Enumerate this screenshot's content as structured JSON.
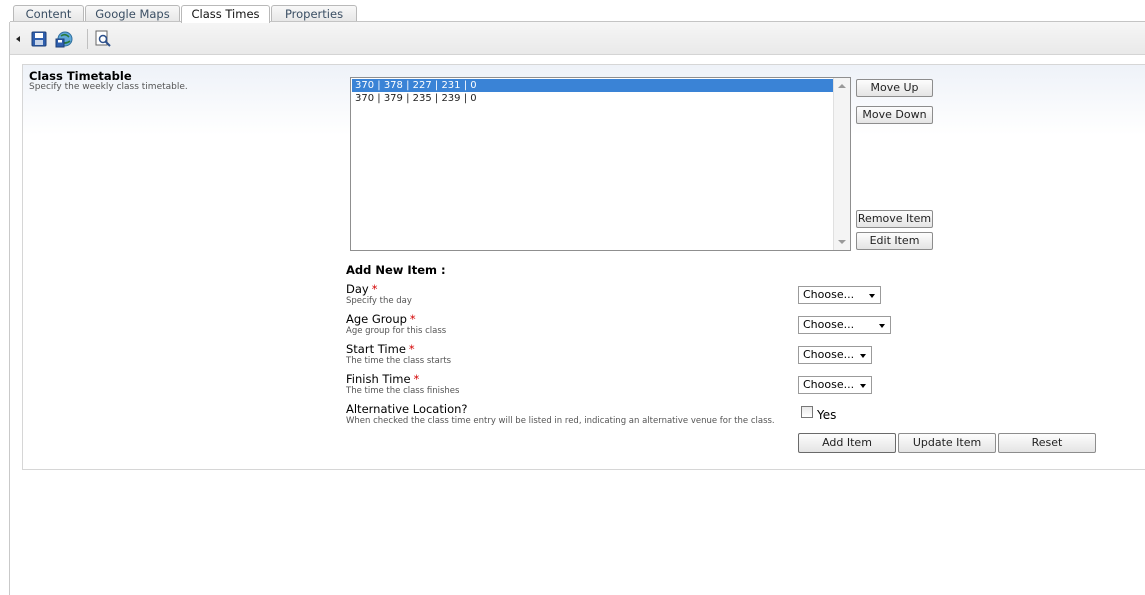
{
  "tabs": [
    "Content",
    "Google Maps",
    "Class Times",
    "Properties"
  ],
  "active_tab": "Class Times",
  "toolbar": {
    "collapse_icon": "collapse-arrow-icon",
    "save_icon": "save-icon",
    "save_publish_icon": "save-and-publish-icon",
    "preview_icon": "preview-icon"
  },
  "section": {
    "title": "Class Timetable",
    "description": "Specify the weekly class timetable."
  },
  "list": {
    "items": [
      "370 | 378 | 227 | 231 | 0",
      "370 | 379 | 235 | 239 | 0"
    ],
    "selected_index": 0
  },
  "buttons": {
    "move_up": "Move Up",
    "move_down": "Move Down",
    "remove_item": "Remove Item",
    "edit_item": "Edit Item",
    "add_item": "Add Item",
    "update_item": "Update Item",
    "reset": "Reset"
  },
  "add_new": {
    "heading": "Add New Item :",
    "required_marker": "*",
    "day": {
      "label": "Day",
      "hint": "Specify the day",
      "value": "Choose..."
    },
    "age_group": {
      "label": "Age Group",
      "hint": "Age group for this class",
      "value": "Choose..."
    },
    "start_time": {
      "label": "Start Time",
      "hint": "The time the class starts",
      "value": "Choose..."
    },
    "finish_time": {
      "label": "Finish Time",
      "hint": "The time the class finishes",
      "value": "Choose..."
    },
    "alt_location": {
      "label": "Alternative Location?",
      "hint": "When checked the class time entry will be listed in red, indicating an alternative venue for the class.",
      "checkbox_label": "Yes",
      "checked": false
    }
  },
  "colors": {
    "selected_row": "#3a83d6",
    "required": "#d40000",
    "tab_text": "#3a4e63"
  }
}
